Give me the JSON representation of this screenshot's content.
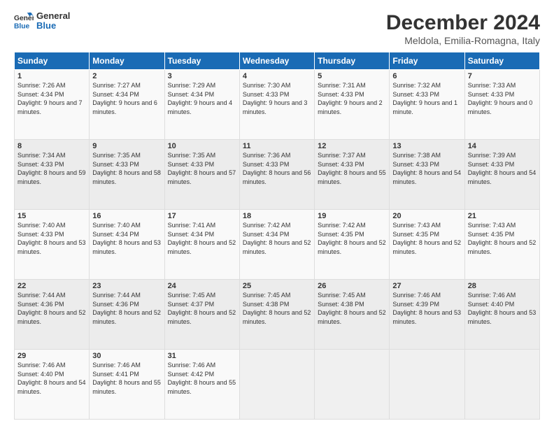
{
  "logo": {
    "line1": "General",
    "line2": "Blue"
  },
  "title": "December 2024",
  "subtitle": "Meldola, Emilia-Romagna, Italy",
  "days_of_week": [
    "Sunday",
    "Monday",
    "Tuesday",
    "Wednesday",
    "Thursday",
    "Friday",
    "Saturday"
  ],
  "weeks": [
    [
      {
        "day": "1",
        "sunrise": "7:26 AM",
        "sunset": "4:34 PM",
        "daylight": "9 hours and 7 minutes."
      },
      {
        "day": "2",
        "sunrise": "7:27 AM",
        "sunset": "4:34 PM",
        "daylight": "9 hours and 6 minutes."
      },
      {
        "day": "3",
        "sunrise": "7:29 AM",
        "sunset": "4:34 PM",
        "daylight": "9 hours and 4 minutes."
      },
      {
        "day": "4",
        "sunrise": "7:30 AM",
        "sunset": "4:33 PM",
        "daylight": "9 hours and 3 minutes."
      },
      {
        "day": "5",
        "sunrise": "7:31 AM",
        "sunset": "4:33 PM",
        "daylight": "9 hours and 2 minutes."
      },
      {
        "day": "6",
        "sunrise": "7:32 AM",
        "sunset": "4:33 PM",
        "daylight": "9 hours and 1 minute."
      },
      {
        "day": "7",
        "sunrise": "7:33 AM",
        "sunset": "4:33 PM",
        "daylight": "9 hours and 0 minutes."
      }
    ],
    [
      {
        "day": "8",
        "sunrise": "7:34 AM",
        "sunset": "4:33 PM",
        "daylight": "8 hours and 59 minutes."
      },
      {
        "day": "9",
        "sunrise": "7:35 AM",
        "sunset": "4:33 PM",
        "daylight": "8 hours and 58 minutes."
      },
      {
        "day": "10",
        "sunrise": "7:35 AM",
        "sunset": "4:33 PM",
        "daylight": "8 hours and 57 minutes."
      },
      {
        "day": "11",
        "sunrise": "7:36 AM",
        "sunset": "4:33 PM",
        "daylight": "8 hours and 56 minutes."
      },
      {
        "day": "12",
        "sunrise": "7:37 AM",
        "sunset": "4:33 PM",
        "daylight": "8 hours and 55 minutes."
      },
      {
        "day": "13",
        "sunrise": "7:38 AM",
        "sunset": "4:33 PM",
        "daylight": "8 hours and 54 minutes."
      },
      {
        "day": "14",
        "sunrise": "7:39 AM",
        "sunset": "4:33 PM",
        "daylight": "8 hours and 54 minutes."
      }
    ],
    [
      {
        "day": "15",
        "sunrise": "7:40 AM",
        "sunset": "4:33 PM",
        "daylight": "8 hours and 53 minutes."
      },
      {
        "day": "16",
        "sunrise": "7:40 AM",
        "sunset": "4:34 PM",
        "daylight": "8 hours and 53 minutes."
      },
      {
        "day": "17",
        "sunrise": "7:41 AM",
        "sunset": "4:34 PM",
        "daylight": "8 hours and 52 minutes."
      },
      {
        "day": "18",
        "sunrise": "7:42 AM",
        "sunset": "4:34 PM",
        "daylight": "8 hours and 52 minutes."
      },
      {
        "day": "19",
        "sunrise": "7:42 AM",
        "sunset": "4:35 PM",
        "daylight": "8 hours and 52 minutes."
      },
      {
        "day": "20",
        "sunrise": "7:43 AM",
        "sunset": "4:35 PM",
        "daylight": "8 hours and 52 minutes."
      },
      {
        "day": "21",
        "sunrise": "7:43 AM",
        "sunset": "4:35 PM",
        "daylight": "8 hours and 52 minutes."
      }
    ],
    [
      {
        "day": "22",
        "sunrise": "7:44 AM",
        "sunset": "4:36 PM",
        "daylight": "8 hours and 52 minutes."
      },
      {
        "day": "23",
        "sunrise": "7:44 AM",
        "sunset": "4:36 PM",
        "daylight": "8 hours and 52 minutes."
      },
      {
        "day": "24",
        "sunrise": "7:45 AM",
        "sunset": "4:37 PM",
        "daylight": "8 hours and 52 minutes."
      },
      {
        "day": "25",
        "sunrise": "7:45 AM",
        "sunset": "4:38 PM",
        "daylight": "8 hours and 52 minutes."
      },
      {
        "day": "26",
        "sunrise": "7:45 AM",
        "sunset": "4:38 PM",
        "daylight": "8 hours and 52 minutes."
      },
      {
        "day": "27",
        "sunrise": "7:46 AM",
        "sunset": "4:39 PM",
        "daylight": "8 hours and 53 minutes."
      },
      {
        "day": "28",
        "sunrise": "7:46 AM",
        "sunset": "4:40 PM",
        "daylight": "8 hours and 53 minutes."
      }
    ],
    [
      {
        "day": "29",
        "sunrise": "7:46 AM",
        "sunset": "4:40 PM",
        "daylight": "8 hours and 54 minutes."
      },
      {
        "day": "30",
        "sunrise": "7:46 AM",
        "sunset": "4:41 PM",
        "daylight": "8 hours and 55 minutes."
      },
      {
        "day": "31",
        "sunrise": "7:46 AM",
        "sunset": "4:42 PM",
        "daylight": "8 hours and 55 minutes."
      },
      null,
      null,
      null,
      null
    ]
  ]
}
